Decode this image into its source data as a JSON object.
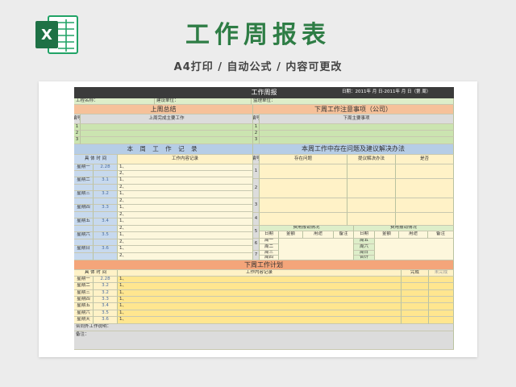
{
  "header": {
    "title": "工作周报表",
    "subtitle": "A4打印 / 自动公式 / 内容可更改",
    "logo_letter": "X"
  },
  "sheet": {
    "title": "工作周报",
    "date_label": "日期：2011年 月 日-2011年 月 日（第 周）",
    "project_label": "工程名称：",
    "builder_label": "建设单位：",
    "supervisor_label": "监理单位：",
    "last_week_summary": "上周总结",
    "next_week_notes": "下周工作注意事项（公司）",
    "serial": "编号",
    "last_week_main": "上周完成主要工作",
    "next_week_main": "下周主要事项",
    "rows_123": [
      "1",
      "2",
      "3"
    ],
    "this_week_record": "本 周 工 作 记 录",
    "problems_title": "本周工作中存在问题及建议解决办法",
    "day_time": "具 体 时 间",
    "work_content": "工作内容记录",
    "problems": "存在问题",
    "suggestions": "提议解决办法",
    "yes_no": "是否",
    "days": [
      {
        "name": "星期一",
        "date": "2.28"
      },
      {
        "name": "星期二",
        "date": "3.1"
      },
      {
        "name": "星期三",
        "date": "3.2"
      },
      {
        "name": "星期四",
        "date": "3.3"
      },
      {
        "name": "星期五",
        "date": "3.4"
      },
      {
        "name": "星期六",
        "date": "3.5"
      },
      {
        "name": "星期日",
        "date": "3.6"
      }
    ],
    "line1": "1、",
    "line2": "2、",
    "problem_nums": [
      "1",
      "2",
      "3",
      "4",
      "5",
      "6",
      "7"
    ],
    "expense_title": "费用报销情况",
    "exp_cols": [
      "日期",
      "金额",
      "用途",
      "备注"
    ],
    "exp_left_days": [
      "周一",
      "周二",
      "周三",
      "周四"
    ],
    "exp_right_days": [
      "周五",
      "周六",
      "周日",
      "合计"
    ],
    "next_plan": "下周工作计划",
    "done": "完成",
    "not_done": "未完成",
    "next_days": [
      {
        "name": "星期一",
        "date": "2.28"
      },
      {
        "name": "星期二",
        "date": "3.2"
      },
      {
        "name": "星期三",
        "date": "3.2"
      },
      {
        "name": "星期四",
        "date": "3.3"
      },
      {
        "name": "星期五",
        "date": "3.4"
      },
      {
        "name": "星期六",
        "date": "3.5"
      },
      {
        "name": "星期天",
        "date": "3.6"
      }
    ],
    "contract_note": "合同外工作说明：",
    "remark": "备注："
  }
}
